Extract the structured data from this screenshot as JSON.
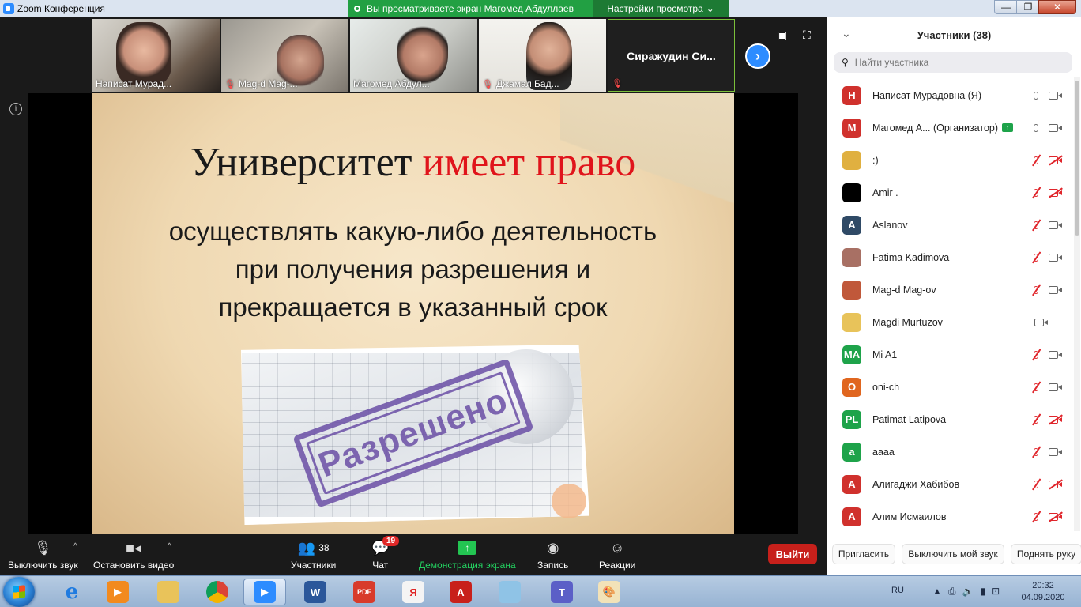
{
  "window": {
    "title": "Zoom Конференция",
    "share_banner": "Вы просматриваете экран Магомед Абдуллаев",
    "view_options": "Настройки просмотра",
    "min": "—",
    "max": "❐",
    "close": "✕"
  },
  "thumbnails": [
    {
      "name": "Написат Мурад...",
      "muted": false
    },
    {
      "name": "Mag-d Mag-...",
      "muted": true
    },
    {
      "name": "Магомед Абдул...",
      "muted": false
    },
    {
      "name": "Джамал Бад...",
      "muted": true
    },
    {
      "name": "Сиражудин  Си...",
      "muted": true
    }
  ],
  "slide": {
    "title_black": "Университет",
    "title_red": "имеет право",
    "line1": "осуществлять какую-либо  деятельность",
    "line2": "при получения разрешения и",
    "line3": "прекращается в указанный срок",
    "stamp": "Разрешено"
  },
  "toolbar": {
    "mute": "Выключить звук",
    "stop_video": "Остановить видео",
    "participants": "Участники",
    "participants_count": "38",
    "chat": "Чат",
    "chat_badge": "19",
    "share": "Демонстрация экрана",
    "record": "Запись",
    "reactions": "Реакции",
    "leave": "Выйти"
  },
  "panel": {
    "title": "Участники (38)",
    "search_placeholder": "Найти участника",
    "participants": [
      {
        "initials": "Н",
        "color": "#d0312d",
        "name": "Написат Мурадовна (Я)",
        "host": false,
        "mic_off": false,
        "cam_off": false,
        "mic_shown": true
      },
      {
        "initials": "М",
        "color": "#d0312d",
        "name": "Магомед А...  (Организатор)",
        "host": true,
        "mic_off": false,
        "cam_off": false,
        "mic_shown": true
      },
      {
        "initials": "",
        "color": "#e0b040",
        "name": ":)",
        "host": false,
        "mic_off": true,
        "cam_off": true,
        "mic_shown": true
      },
      {
        "initials": "",
        "color": "#000000",
        "name": "Amir .",
        "host": false,
        "mic_off": true,
        "cam_off": true,
        "mic_shown": true
      },
      {
        "initials": "A",
        "color": "#2f4a66",
        "name": "Aslanov",
        "host": false,
        "mic_off": true,
        "cam_off": false,
        "mic_shown": true
      },
      {
        "initials": "",
        "color": "#a87064",
        "name": "Fatima Kadimova",
        "host": false,
        "mic_off": true,
        "cam_off": false,
        "mic_shown": true
      },
      {
        "initials": "",
        "color": "#c0583a",
        "name": "Mag-d Mag-ov",
        "host": false,
        "mic_off": true,
        "cam_off": false,
        "mic_shown": true
      },
      {
        "initials": "",
        "color": "#e8c35a",
        "name": "Magdi Murtuzov",
        "host": false,
        "mic_off": true,
        "cam_off": false,
        "mic_shown": false
      },
      {
        "initials": "MA",
        "color": "#1ea34a",
        "name": "Mi A1",
        "host": false,
        "mic_off": true,
        "cam_off": false,
        "mic_shown": true
      },
      {
        "initials": "O",
        "color": "#e0661f",
        "name": "oni-ch",
        "host": false,
        "mic_off": true,
        "cam_off": false,
        "mic_shown": true
      },
      {
        "initials": "PL",
        "color": "#1ea34a",
        "name": "Patimat Latipova",
        "host": false,
        "mic_off": true,
        "cam_off": true,
        "mic_shown": true
      },
      {
        "initials": "a",
        "color": "#1ea34a",
        "name": "aaaa",
        "host": false,
        "mic_off": true,
        "cam_off": false,
        "mic_shown": true
      },
      {
        "initials": "А",
        "color": "#d0312d",
        "name": "Алигаджи Хабибов",
        "host": false,
        "mic_off": true,
        "cam_off": true,
        "mic_shown": true
      },
      {
        "initials": "А",
        "color": "#d0312d",
        "name": "Алим Исмаилов",
        "host": false,
        "mic_off": true,
        "cam_off": true,
        "mic_shown": true
      }
    ],
    "invite": "Пригласить",
    "mute_me": "Выключить мой звук",
    "raise_hand": "Поднять руку"
  },
  "taskbar": {
    "lang": "RU",
    "time": "20:32",
    "date": "04.09.2020"
  }
}
